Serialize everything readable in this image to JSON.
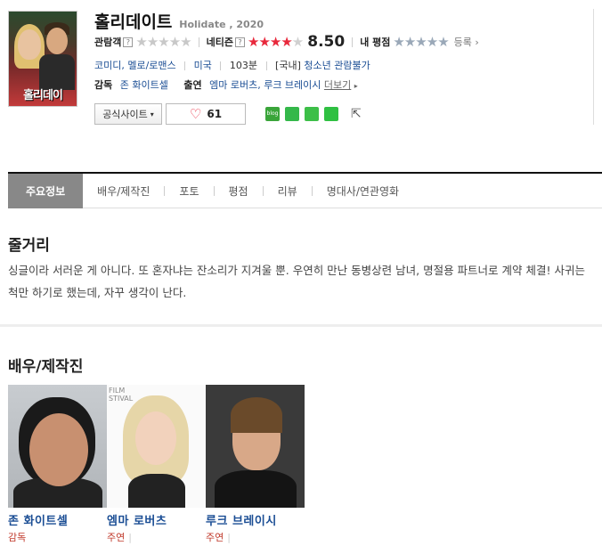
{
  "movie": {
    "title_ko": "홀리데이트",
    "title_en": "Holidate , 2020",
    "poster_title": "홀리데이"
  },
  "ratings": {
    "audience_label": "관람객",
    "audience_stars": 0,
    "netizen_label": "네티즌",
    "netizen_stars": 4.25,
    "netizen_score": "8.50",
    "my_label": "내 평점",
    "register_label": "등록",
    "help_glyph": "?"
  },
  "info": {
    "genres": "코미디, 멜로/로맨스",
    "country": "미국",
    "runtime": "103분",
    "rating_prefix": "[국내]",
    "rating": "청소년 관람불가"
  },
  "crew": {
    "director_label": "감독",
    "director": "존 화이트셀",
    "cast_label": "출연",
    "cast": "엠마 로버츠, 루크 브레이시",
    "more_label": "더보기"
  },
  "buttons": {
    "official_site": "공식사이트",
    "likes": "61"
  },
  "tabs": [
    {
      "label": "주요정보",
      "active": true
    },
    {
      "label": "배우/제작진"
    },
    {
      "label": "포토"
    },
    {
      "label": "평점"
    },
    {
      "label": "리뷰"
    },
    {
      "label": "명대사/연관영화"
    }
  ],
  "synopsis": {
    "title": "줄거리",
    "text": "싱글이라 서러운 게 아니다. 또 혼자냐는 잔소리가 지겨울 뿐. 우연히 만난 동병상련 남녀, 명절용 파트너로 계약 체결! 사귀는 척만 하기로 했는데, 자꾸 생각이 난다."
  },
  "cast_section": {
    "title": "배우/제작진",
    "people": [
      {
        "name": "존 화이트셀",
        "role": "감독"
      },
      {
        "name": "엠마 로버츠",
        "role": "주연"
      },
      {
        "name": "루크 브레이시",
        "role": "주연"
      }
    ],
    "photo2_text": "FILM\nSTIVAL"
  },
  "colors": {
    "accent_red": "#e8283c",
    "link_blue": "#1a4d94",
    "tab_active_bg": "#888888"
  }
}
